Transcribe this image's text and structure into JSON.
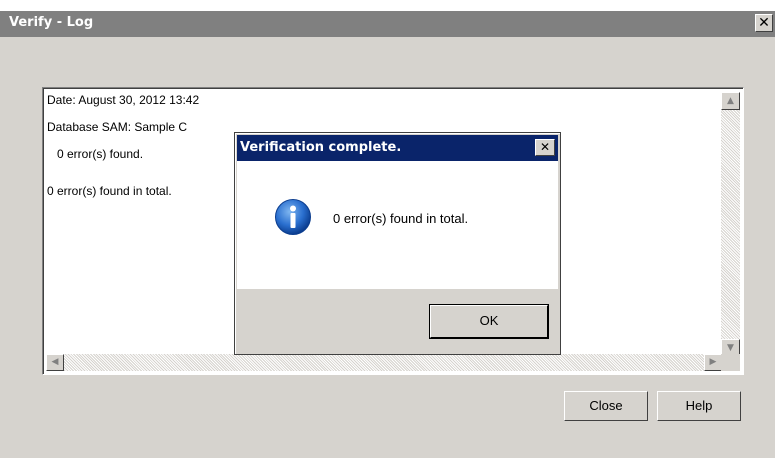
{
  "window": {
    "title": "Verify - Log",
    "close_glyph": "✕"
  },
  "log": {
    "lines": [
      "Date: August 30, 2012 13:42",
      "Database SAM: Sample C",
      "0 error(s) found.",
      "0 error(s) found in total."
    ]
  },
  "scrollbars": {
    "up_arrow": "▲",
    "down_arrow": "▼",
    "left_arrow": "◀",
    "right_arrow": "▶"
  },
  "buttons": {
    "close_label": "Close",
    "help_label": "Help"
  },
  "dialog": {
    "title": "Verification complete.",
    "close_glyph": "✕",
    "message": "0 error(s) found in total.",
    "icon": "info-icon",
    "ok_label": "OK"
  },
  "colors": {
    "window_bg": "#d6d3ce",
    "titlebar_inactive": "#808080",
    "titlebar_active": "#0a246a",
    "info_icon_blue": "#1a5fc0"
  }
}
